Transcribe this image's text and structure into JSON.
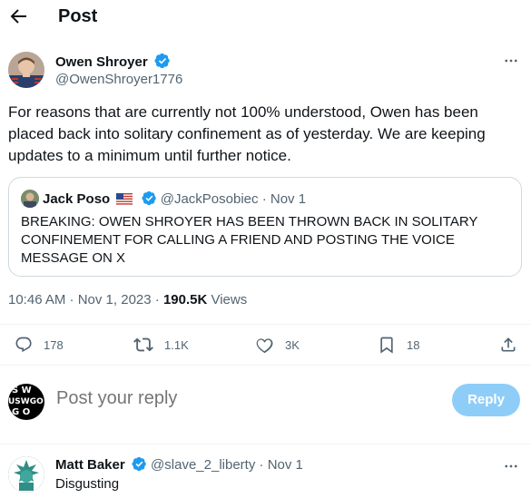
{
  "header": {
    "title": "Post"
  },
  "tweet": {
    "author_name": "Owen Shroyer",
    "author_handle": "@OwenShroyer1776",
    "text": "For reasons that are currently not 100% understood, Owen has been placed back into solitary confinement as of yesterday. We are keeping updates to a minimum until further notice.",
    "quote": {
      "name": "Jack Poso",
      "handle": "@JackPosobiec",
      "date": "Nov 1",
      "text": "BREAKING: OWEN SHROYER HAS BEEN THROWN BACK IN SOLITARY CONFINEMENT FOR CALLING A FRIEND AND POSTING THE VOICE MESSAGE ON X"
    },
    "time": "10:46 AM · Nov 1, 2023 · ",
    "views_count": "190.5K",
    "views_label": " Views",
    "actions": {
      "replies": "178",
      "reposts": "1.1K",
      "likes": "3K",
      "bookmarks": "18"
    }
  },
  "reply_box": {
    "placeholder": "Post your reply",
    "button": "Reply",
    "avatar_lines": [
      "S W",
      "USWGO",
      "G O"
    ]
  },
  "comments": [
    {
      "name": "Matt Baker",
      "handle": "@slave_2_liberty",
      "date": "Nov 1",
      "text": "Disgusting"
    }
  ],
  "colors": {
    "accent": "#1d9bf0",
    "reply_button": "#8ecdf8",
    "secondary_text": "#536471",
    "border": "#cfd9de"
  },
  "icons": [
    "back-arrow-icon",
    "verified-icon",
    "more-icon",
    "us-flag-icon",
    "reply-icon",
    "repost-icon",
    "like-icon",
    "bookmark-icon",
    "share-icon"
  ]
}
